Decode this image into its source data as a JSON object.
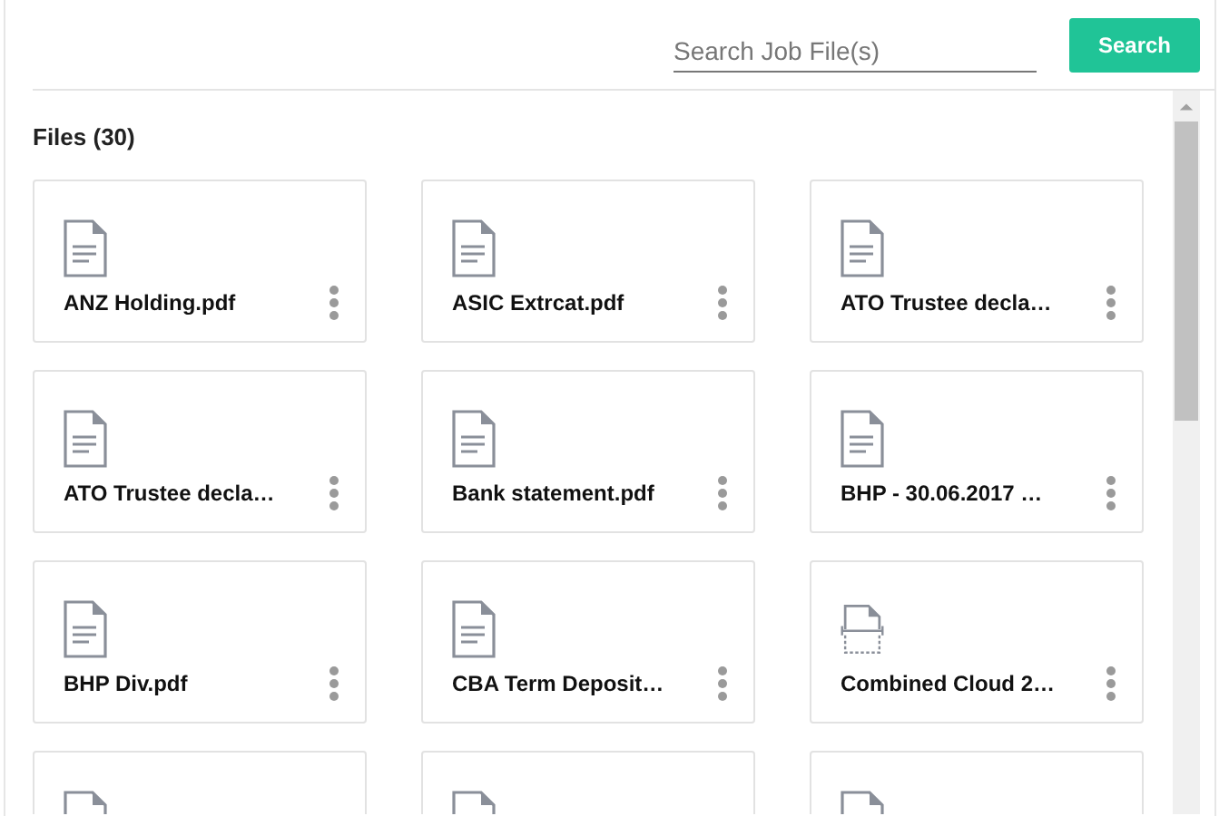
{
  "search": {
    "placeholder": "Search Job File(s)",
    "button": "Search"
  },
  "files_heading": "Files (30)",
  "files": [
    {
      "kind": "doc",
      "name": "ANZ Holding.pdf"
    },
    {
      "kind": "doc",
      "name": "ASIC Extrcat.pdf"
    },
    {
      "kind": "doc",
      "name": "ATO Trustee decla…"
    },
    {
      "kind": "doc",
      "name": "ATO Trustee decla…"
    },
    {
      "kind": "doc",
      "name": "Bank statement.pdf"
    },
    {
      "kind": "doc",
      "name": "BHP - 30.06.2017 …"
    },
    {
      "kind": "doc",
      "name": "BHP Div.pdf"
    },
    {
      "kind": "doc",
      "name": "CBA Term Deposit…"
    },
    {
      "kind": "scan",
      "name": "Combined Cloud 2…"
    },
    {
      "kind": "doc"
    },
    {
      "kind": "doc"
    },
    {
      "kind": "doc"
    }
  ]
}
